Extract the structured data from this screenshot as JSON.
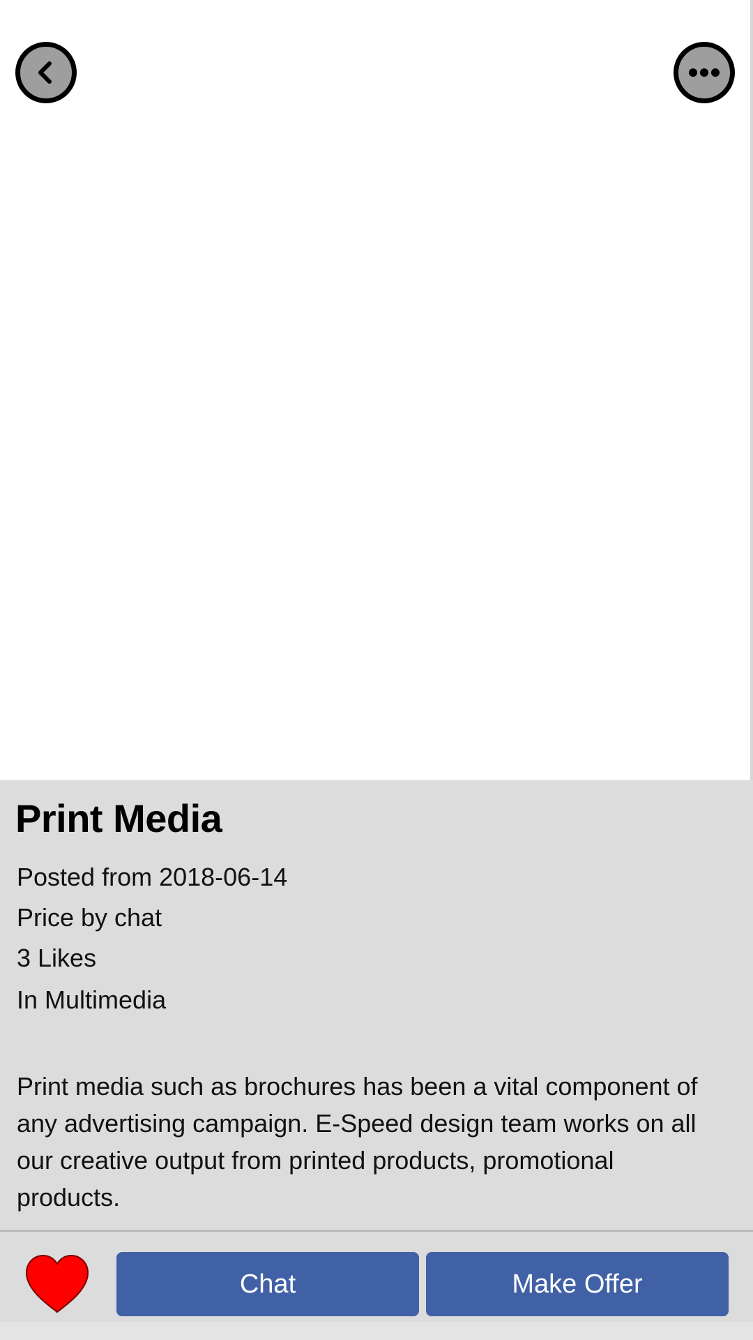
{
  "header": {
    "back_icon": "chevron-left-icon",
    "more_icon": "more-horizontal-icon"
  },
  "listing": {
    "title": "Print Media",
    "posted": "Posted from 2018-06-14",
    "price": "Price by chat",
    "likes": "3 Likes",
    "category": "In Multimedia",
    "description": "Print media such as brochures has been a vital component of any advertising campaign. E-Speed design team works on all our creative output from printed products, promotional products."
  },
  "actions": {
    "like_icon": "heart-icon",
    "like_color": "#ff0000",
    "chat_label": "Chat",
    "offer_label": "Make Offer",
    "button_color": "#4161a6"
  }
}
